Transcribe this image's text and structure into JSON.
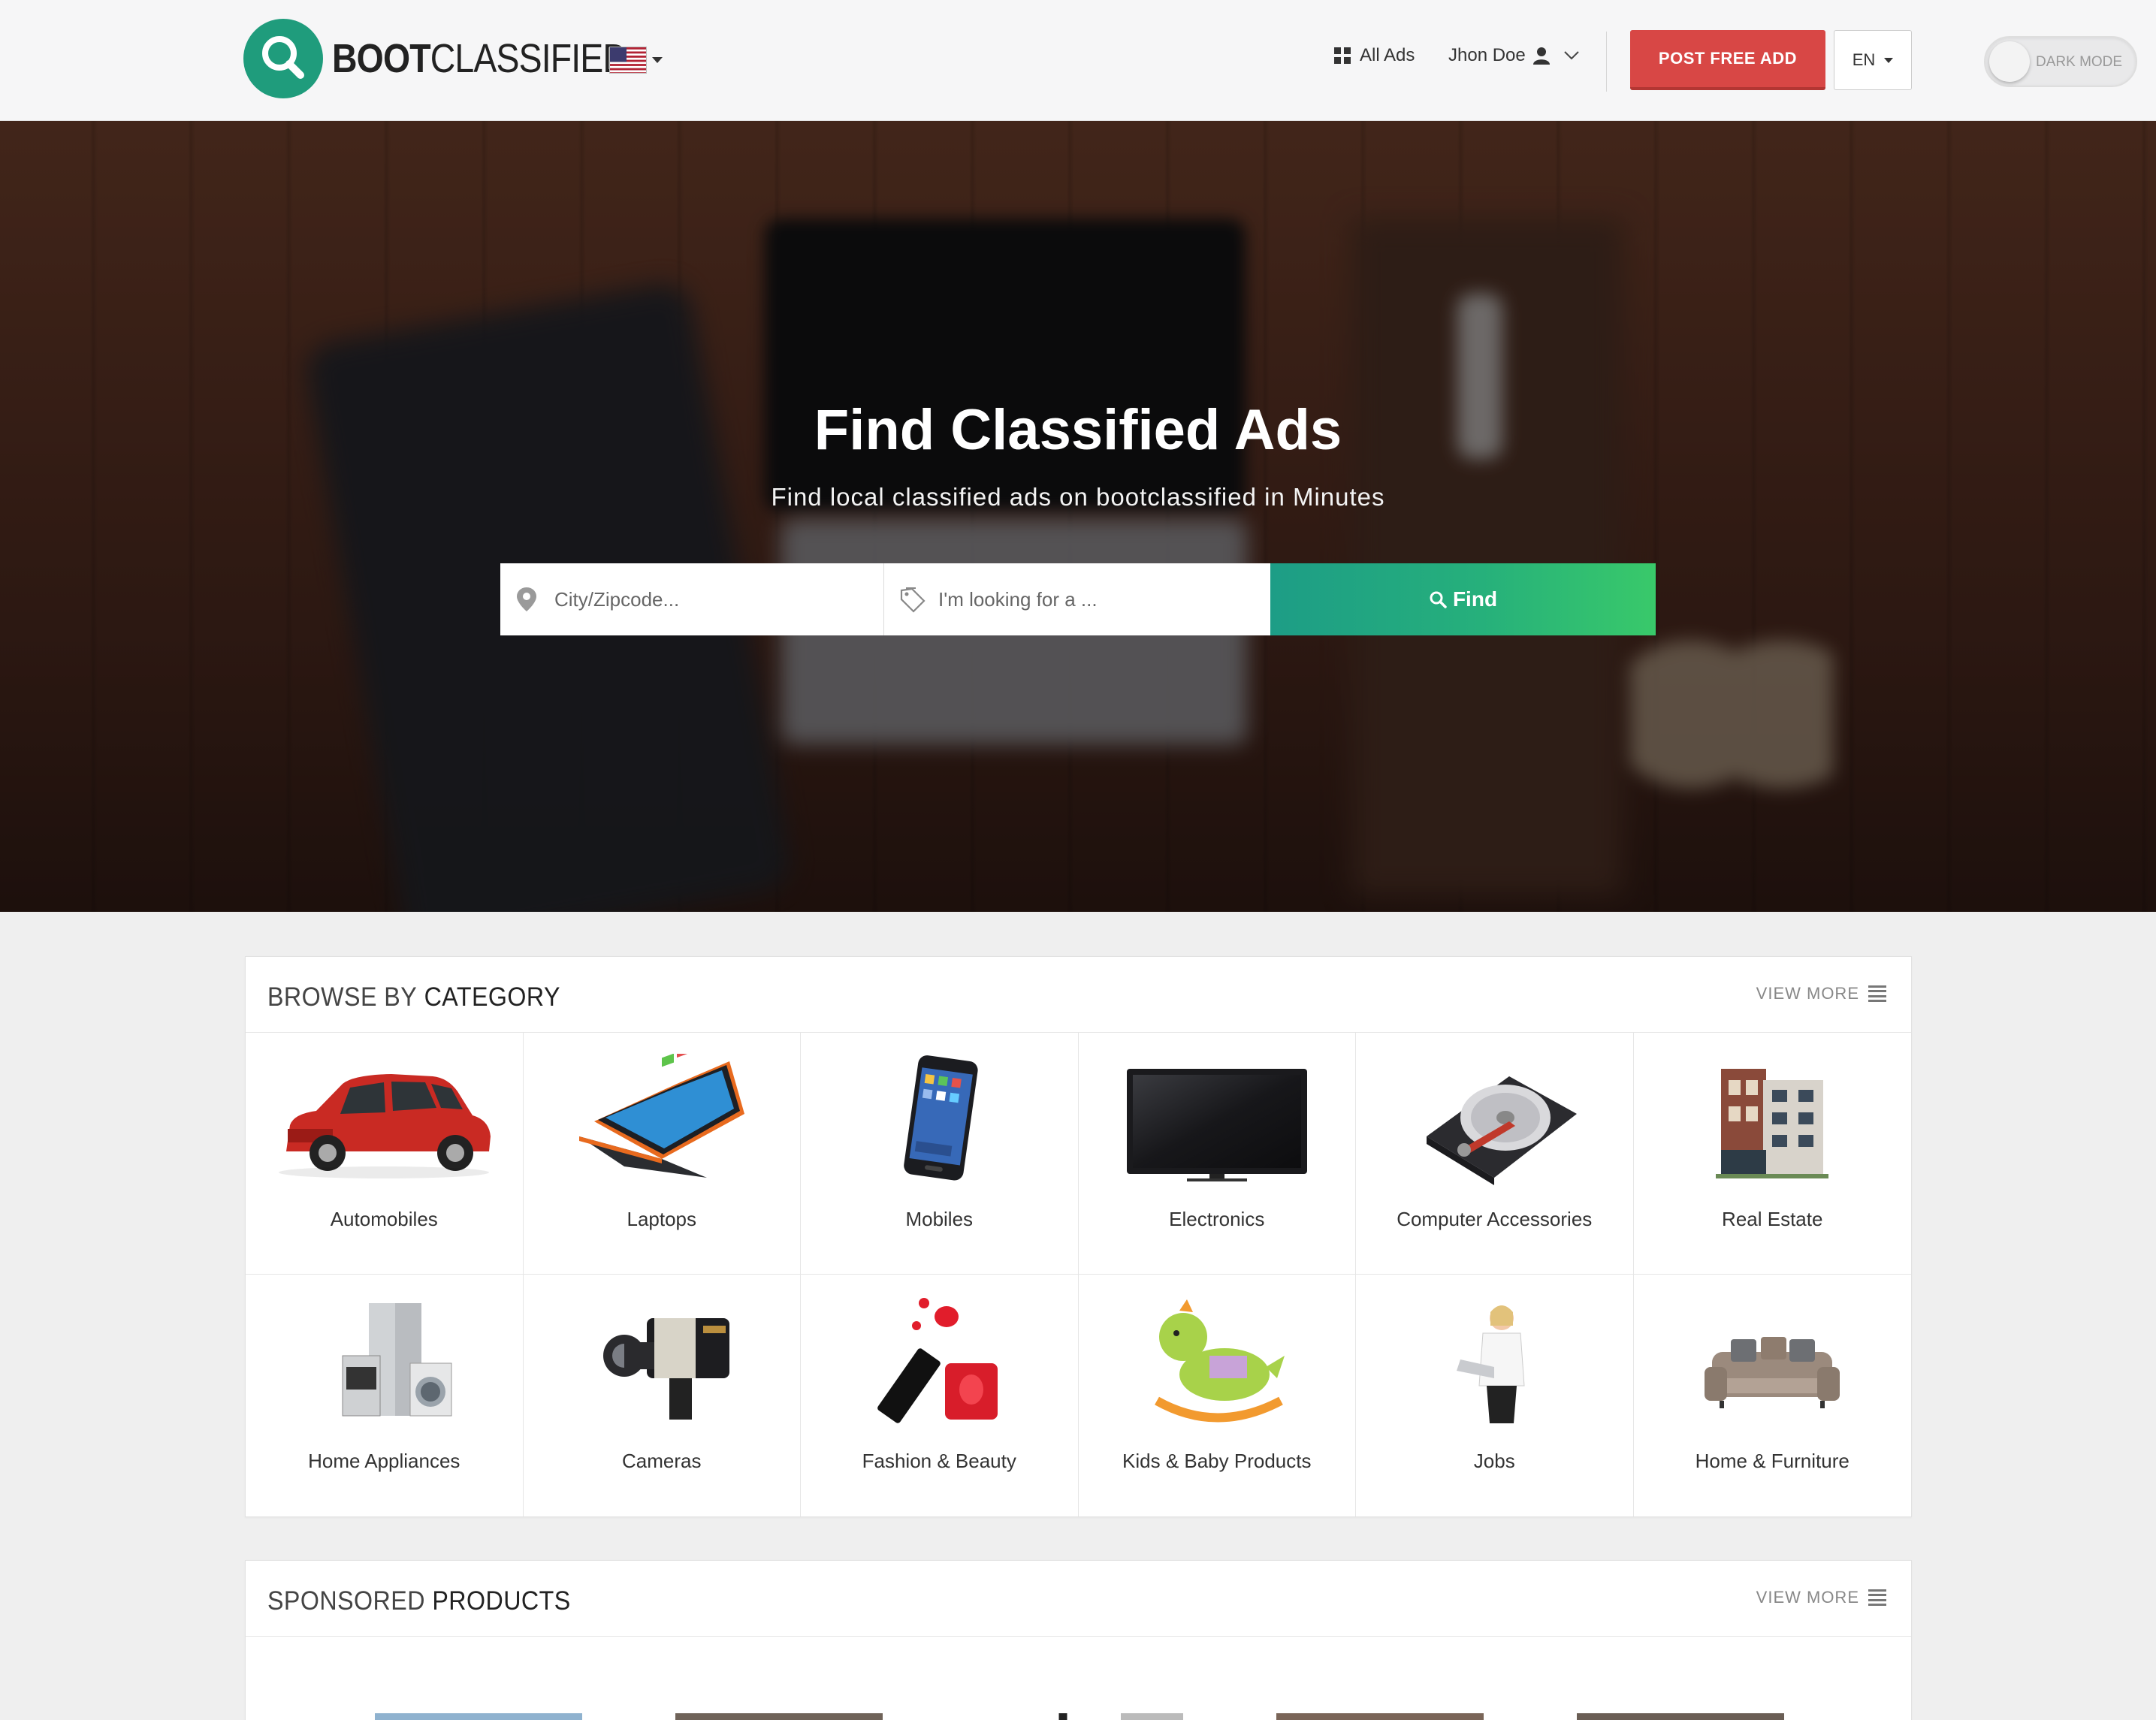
{
  "header": {
    "logo": {
      "bold": "BOOT",
      "light": "CLASSIFIED"
    },
    "country_flag": "us-flag-icon",
    "nav": {
      "all_ads": "All Ads",
      "user_name": "Jhon Doe"
    },
    "post_button": "POST FREE ADD",
    "language": "EN",
    "dark_mode_label": "DARK MODE"
  },
  "hero": {
    "title": "Find Classified Ads",
    "subtitle": "Find local classified ads on bootclassified in Minutes",
    "search": {
      "city_placeholder": "City/Zipcode...",
      "query_placeholder": "I'm looking for a ...",
      "find_label": "Find"
    }
  },
  "categories": {
    "title_light": "BROWSE BY",
    "title_strong": "CATEGORY",
    "view_more": "VIEW MORE",
    "items": [
      {
        "label": "Automobiles",
        "icon": "car-image"
      },
      {
        "label": "Laptops",
        "icon": "laptop-image"
      },
      {
        "label": "Mobiles",
        "icon": "smartphone-image"
      },
      {
        "label": "Electronics",
        "icon": "tv-image"
      },
      {
        "label": "Computer Accessories",
        "icon": "hard-drive-image"
      },
      {
        "label": "Real Estate",
        "icon": "building-image"
      },
      {
        "label": "Home Appliances",
        "icon": "appliances-image"
      },
      {
        "label": "Cameras",
        "icon": "camera-image"
      },
      {
        "label": "Fashion & Beauty",
        "icon": "nail-polish-image"
      },
      {
        "label": "Kids & Baby Products",
        "icon": "rocking-toy-image"
      },
      {
        "label": "Jobs",
        "icon": "businesswoman-image"
      },
      {
        "label": "Home & Furniture",
        "icon": "sofa-image"
      }
    ]
  },
  "sponsored": {
    "title_light": "SPONSORED",
    "title_strong": "PRODUCTS",
    "view_more": "VIEW MORE"
  },
  "colors": {
    "brand_green": "#1f9c7c",
    "post_red": "#d84745",
    "find_gradient_start": "#1d9d86",
    "find_gradient_end": "#39c96a"
  }
}
